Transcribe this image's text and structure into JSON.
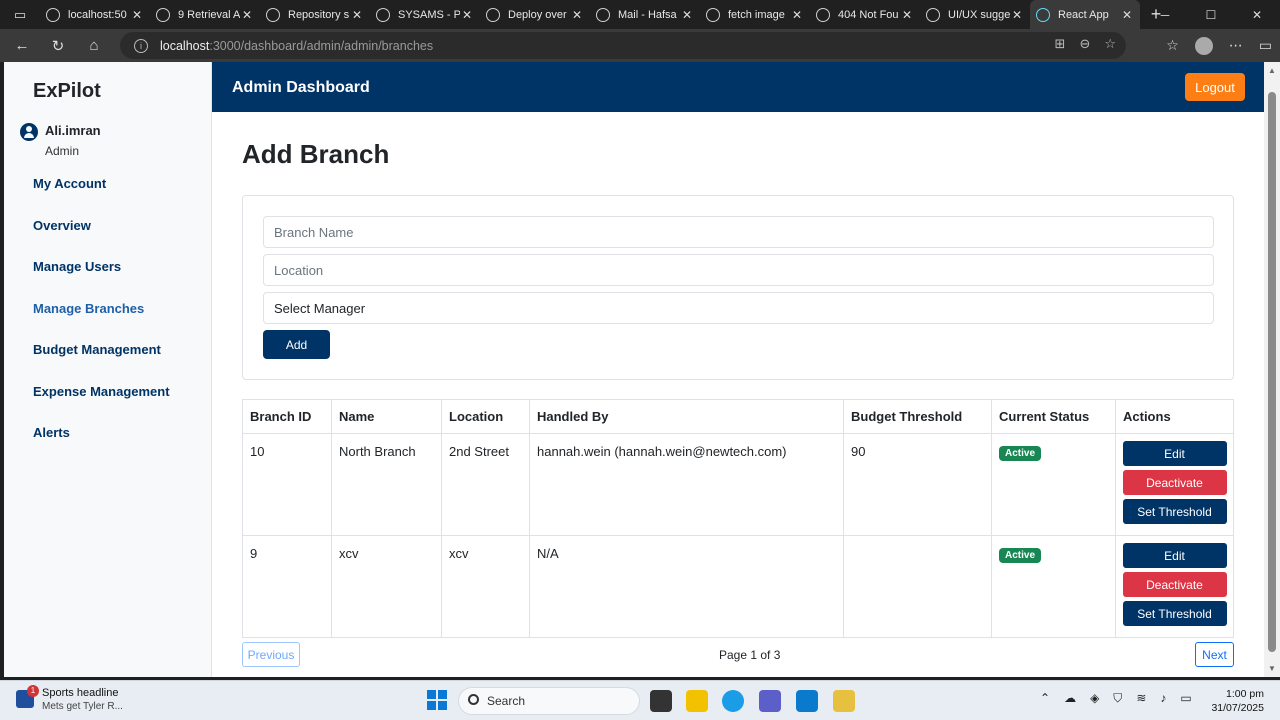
{
  "browser": {
    "tabs": [
      {
        "title": "localhost:50",
        "active": false
      },
      {
        "title": "9 Retrieval A",
        "active": false
      },
      {
        "title": "Repository s",
        "active": false
      },
      {
        "title": "SYSAMS - P",
        "active": false
      },
      {
        "title": "Deploy over",
        "active": false
      },
      {
        "title": "Mail - Hafsa",
        "active": false
      },
      {
        "title": "fetch image",
        "active": false
      },
      {
        "title": "404 Not Fou",
        "active": false
      },
      {
        "title": "UI/UX sugge",
        "active": false
      },
      {
        "title": "React App",
        "active": true
      }
    ],
    "url_host": "localhost",
    "url_path": ":3000/dashboard/admin/admin/branches"
  },
  "sidebar": {
    "brand": "ExPilot",
    "user_name": "Ali.imran",
    "user_role": "Admin",
    "items": [
      {
        "label": "My Account",
        "active": false
      },
      {
        "label": "Overview",
        "active": false
      },
      {
        "label": "Manage Users",
        "active": false
      },
      {
        "label": "Manage Branches",
        "active": true
      },
      {
        "label": "Budget Management",
        "active": false
      },
      {
        "label": "Expense Management",
        "active": false
      },
      {
        "label": "Alerts",
        "active": false
      }
    ]
  },
  "header": {
    "title": "Admin Dashboard",
    "logout_label": "Logout"
  },
  "main": {
    "title": "Add Branch",
    "form": {
      "branch_name_placeholder": "Branch Name",
      "location_placeholder": "Location",
      "manager_select_value": "Select Manager",
      "add_label": "Add"
    },
    "table": {
      "columns": [
        "Branch ID",
        "Name",
        "Location",
        "Handled By",
        "Budget Threshold",
        "Current Status",
        "Actions"
      ],
      "rows": [
        {
          "id": "10",
          "name": "North Branch",
          "location": "2nd Street",
          "handled_by": "hannah.wein (hannah.wein@newtech.com)",
          "budget_threshold": "90",
          "status": "Active"
        },
        {
          "id": "9",
          "name": "xcv",
          "location": "xcv",
          "handled_by": "N/A",
          "budget_threshold": "",
          "status": "Active"
        }
      ],
      "action_labels": {
        "edit": "Edit",
        "deactivate": "Deactivate",
        "set_threshold": "Set Threshold"
      }
    },
    "pagination": {
      "previous_label": "Previous",
      "next_label": "Next",
      "page_info": "Page 1 of 3"
    }
  },
  "taskbar": {
    "news_title": "Sports headline",
    "news_subtitle": "Mets get Tyler R...",
    "news_badge": "1",
    "search_label": "Search",
    "time": "1:00 pm",
    "date": "31/07/2025"
  },
  "colors": {
    "primary": "#003366",
    "logout": "#fd7e14",
    "danger": "#dc3545",
    "success": "#198754"
  }
}
